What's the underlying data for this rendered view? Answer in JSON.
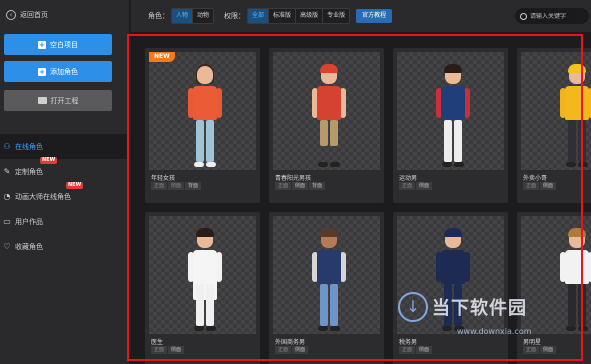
{
  "sidebar": {
    "back_label": "返回首页",
    "buttons": {
      "new_project": "空白项目",
      "add_role": "添加角色",
      "open_project": "打开工程"
    },
    "nav": [
      {
        "label": "在线角色",
        "icon": "person-icon",
        "active": true,
        "new": false
      },
      {
        "label": "定制角色",
        "icon": "edit-icon",
        "active": false,
        "new": true
      },
      {
        "label": "动画大师在线角色",
        "icon": "master-icon",
        "active": false,
        "new": true
      },
      {
        "label": "用户作品",
        "icon": "folder-icon",
        "active": false,
        "new": false
      },
      {
        "label": "收藏角色",
        "icon": "heart-icon",
        "active": false,
        "new": false
      }
    ],
    "new_badge": "NEW"
  },
  "toolbar": {
    "role_label": "角色：",
    "role_types": [
      "人物",
      "动物"
    ],
    "perm_label": "权限：",
    "perm_types": [
      "全部",
      "标准版",
      "高级版",
      "专业版"
    ],
    "tutorial": "官方教程",
    "search_placeholder": "请输入关键字"
  },
  "cards": [
    {
      "name": "年轻女孩",
      "tags": [
        "正面",
        "侧面",
        "背面"
      ],
      "new": true
    },
    {
      "name": "青春阳光男孩",
      "tags": [
        "正面",
        "侧面",
        "背面"
      ],
      "new": false
    },
    {
      "name": "运动男",
      "tags": [
        "正面",
        "侧面"
      ],
      "new": false
    },
    {
      "name": "外卖小哥",
      "tags": [
        "正面",
        "侧面"
      ],
      "new": false
    },
    {
      "name": "医生",
      "tags": [
        "正面",
        "侧面"
      ],
      "new": false
    },
    {
      "name": "外国商务男",
      "tags": [
        "正面",
        "侧面"
      ],
      "new": false
    },
    {
      "name": "税务男",
      "tags": [
        "正面",
        "侧面"
      ],
      "new": false
    },
    {
      "name": "男明星",
      "tags": [
        "正面",
        "侧面"
      ],
      "new": false
    }
  ],
  "ribbon": "NEW",
  "watermark": {
    "text": "当下软件园",
    "url": "www.downxia.com"
  },
  "colors": {
    "accent": "#2e8fe8",
    "highlight": "#e8161c",
    "ribbon": "#f07b1d"
  }
}
